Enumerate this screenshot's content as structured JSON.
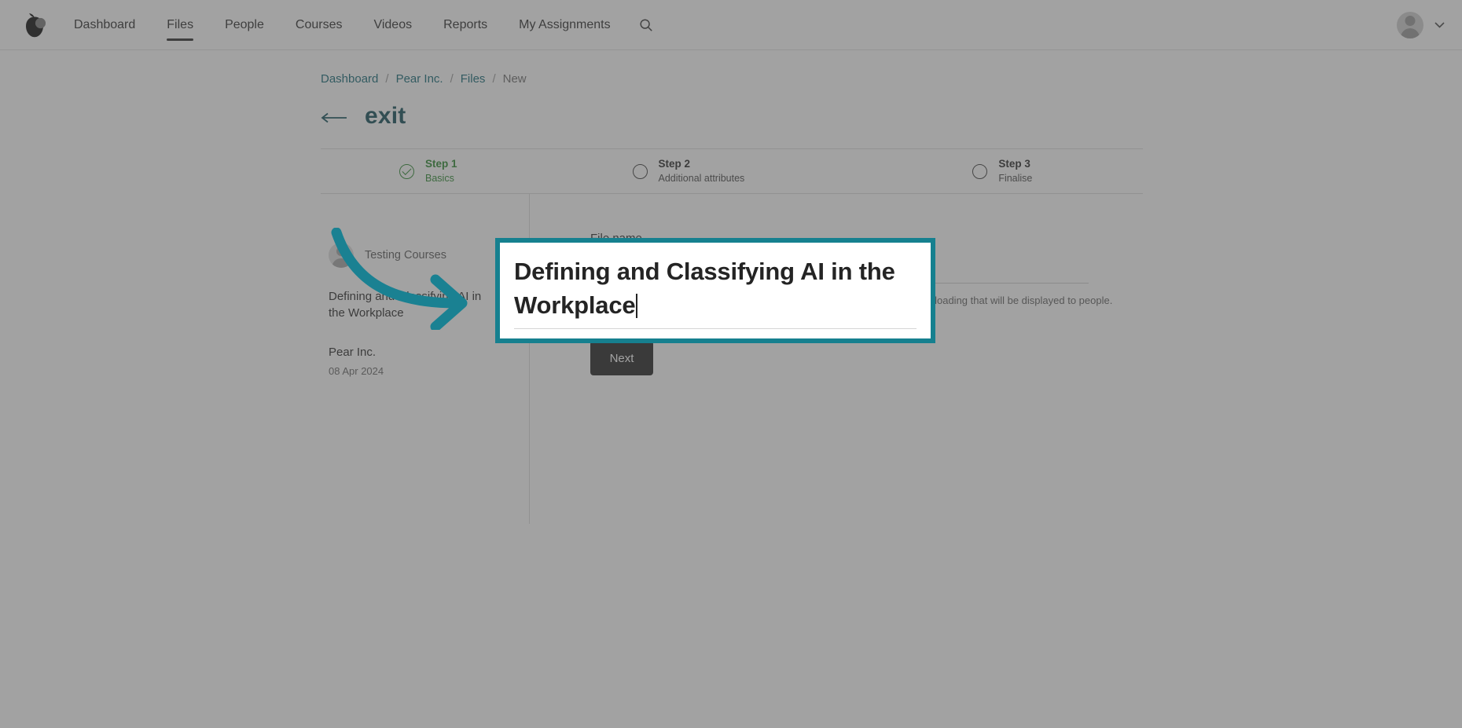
{
  "topnav": {
    "logo_icon": "pear-logo-icon",
    "items": [
      {
        "label": "Dashboard",
        "active": false
      },
      {
        "label": "Files",
        "active": true
      },
      {
        "label": "People",
        "active": false
      },
      {
        "label": "Courses",
        "active": false
      },
      {
        "label": "Videos",
        "active": false
      },
      {
        "label": "Reports",
        "active": false
      },
      {
        "label": "My Assignments",
        "active": false
      }
    ],
    "search_icon": "search-icon",
    "avatar_icon": "user-avatar-icon",
    "chevron_icon": "chevron-down-icon"
  },
  "breadcrumb": {
    "items": [
      {
        "label": "Dashboard",
        "current": false
      },
      {
        "label": "Pear Inc.",
        "current": false
      },
      {
        "label": "Files",
        "current": false
      },
      {
        "label": "New",
        "current": true
      }
    ],
    "separator": "/"
  },
  "exit": {
    "arrow_icon": "arrow-left-icon",
    "label": "exit"
  },
  "stepper": {
    "steps": [
      {
        "title": "Step 1",
        "subtitle": "Basics",
        "state": "done"
      },
      {
        "title": "Step 2",
        "subtitle": "Additional attributes",
        "state": "pending"
      },
      {
        "title": "Step 3",
        "subtitle": "Finalise",
        "state": "pending"
      }
    ]
  },
  "summary": {
    "owner_name": "Testing Courses",
    "file_title": "Defining and Classifying AI in the Workplace",
    "org_name": "Pear Inc.",
    "date": "08 Apr 2024"
  },
  "form": {
    "field_label": "File name",
    "field_value": "Defining and Classifying AI in the Workplace",
    "field_placeholder": "File name",
    "field_help": "This is the name of the PDF document, video, text or URL link you will be uploading that will be displayed to people.",
    "next_label": "Next"
  },
  "highlight": {
    "text": "Defining and Classifying AI in the Workplace",
    "border_color": "#16808f"
  },
  "colors": {
    "accent_teal": "#16808f",
    "link_teal": "#176b78",
    "exit_teal": "#16505b",
    "step_done_green": "#2f8a33",
    "button_dark": "#262626",
    "overlay": "rgba(77,77,77,0.52)"
  }
}
